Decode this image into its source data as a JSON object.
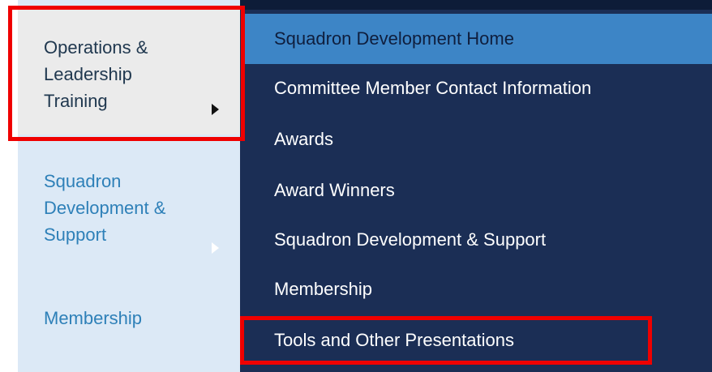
{
  "left_menu": {
    "items": [
      {
        "label": "Operations &\nLeadership\nTraining",
        "has_submenu": true,
        "state": "active"
      },
      {
        "label": "Squadron\nDevelopment &\nSupport",
        "has_submenu": true,
        "state": "default"
      },
      {
        "label": "Membership",
        "has_submenu": false,
        "state": "default"
      }
    ]
  },
  "submenu": {
    "items": [
      {
        "label": "Squadron Development Home",
        "state": "highlighted"
      },
      {
        "label": "Committee Member Contact Information",
        "state": "default"
      },
      {
        "label": "Awards",
        "state": "default"
      },
      {
        "label": "Award Winners",
        "state": "default"
      },
      {
        "label": "Squadron Development & Support",
        "state": "default"
      },
      {
        "label": "Membership",
        "state": "default"
      },
      {
        "label": "Tools and Other Presentations",
        "state": "default"
      }
    ]
  },
  "colors": {
    "left_menu_bg": "#dce9f6",
    "left_active_bg": "#ebebeb",
    "left_link_text": "#2e80b8",
    "submenu_bg": "#1b2e55",
    "submenu_highlight": "#3d85c6",
    "annotation_red": "#ef0000"
  }
}
